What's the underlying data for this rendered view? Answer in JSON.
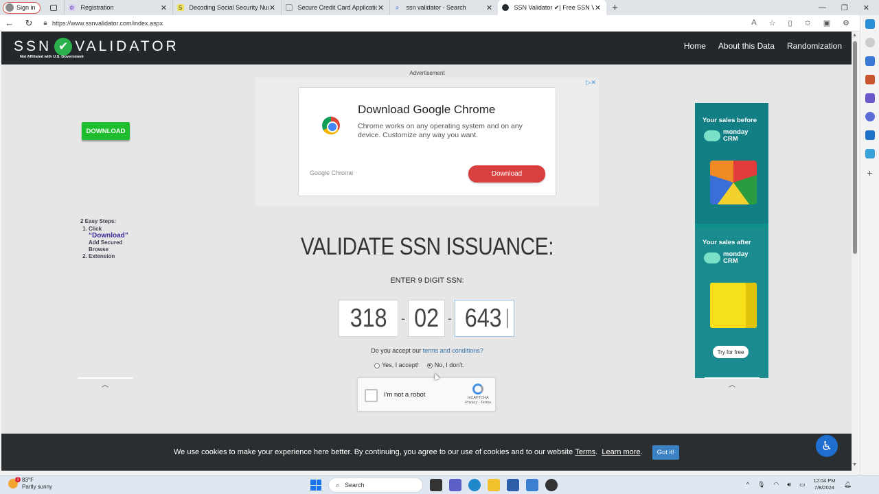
{
  "browser": {
    "signin_label": "Sign in",
    "tabs": [
      {
        "title": "Registration"
      },
      {
        "title": "Decoding Social Security Numbe"
      },
      {
        "title": "Secure Credit Card Application -"
      },
      {
        "title": "ssn validator - Search"
      },
      {
        "title": "SSN Validator ✔| Free SSN Vali"
      }
    ],
    "url": "https://www.ssnvalidator.com/index.aspx"
  },
  "site": {
    "logo_left": "SSN",
    "logo_right": "VALIDATOR",
    "tagline": "Not Affiliated with U.S. Government",
    "nav": [
      "Home",
      "About this Data",
      "Randomization"
    ]
  },
  "ad_top": {
    "label": "Advertisement",
    "title": "Download Google Chrome",
    "description": "Chrome works on any operating system and on any device. Customize any way you want.",
    "brand": "Google Chrome",
    "button": "Download"
  },
  "left_ad": {
    "download_button": "DOWNLOAD",
    "steps_title": "2 Easy Steps:",
    "step1": "Click",
    "step1_link": "“Download”",
    "step2": "Add Secured Browse Extension"
  },
  "side_ad": {
    "before": "Your sales before",
    "after": "Your sales after",
    "brand": "monday",
    "brand_sub": "CRM",
    "cta": "Try for free"
  },
  "validator": {
    "heading": "VALIDATE SSN ISSUANCE:",
    "enter_label": "ENTER 9 DIGIT SSN:",
    "ssn_area": "318",
    "ssn_group": "02",
    "ssn_serial": "643",
    "terms_prefix": "Do you accept our",
    "terms_link": "terms and conditions?",
    "accept_yes": "Yes, I accept!",
    "accept_no": "No, I don't.",
    "captcha_label": "I'm not a robot",
    "captcha_brand": "reCAPTCHA",
    "captcha_links": "Privacy - Terms"
  },
  "cookie": {
    "text": "We use cookies to make your experience here better. By continuing, you agree to our use of cookies and to our website",
    "terms": "Terms",
    "sep": ".",
    "learn": "Learn more",
    "end": ".",
    "button": "Got it!"
  },
  "taskbar": {
    "temp": "83°F",
    "weather": "Partly sunny",
    "weather_badge": "1",
    "search": "Search",
    "time": "12:04 PM",
    "date": "7/8/2024"
  },
  "colors": {
    "header": "#22282b",
    "accent_green": "#2bb24c",
    "cookie_bar": "#2b2e30",
    "gotit": "#3b82c4"
  }
}
